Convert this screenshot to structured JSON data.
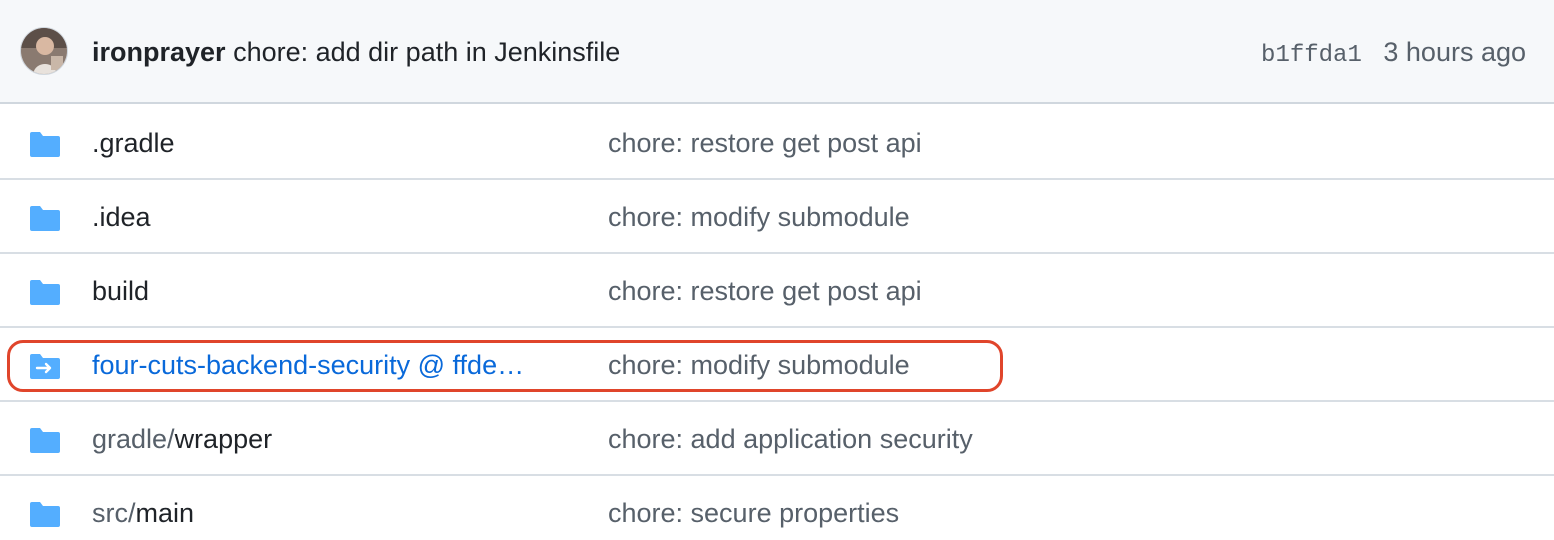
{
  "commit": {
    "author": "ironprayer",
    "message": "chore: add dir path in Jenkinsfile",
    "sha": "b1ffda1",
    "time": "3 hours ago"
  },
  "files": [
    {
      "prefix": "",
      "name": ".gradle",
      "message": "chore: restore get post api",
      "type": "folder"
    },
    {
      "prefix": "",
      "name": ".idea",
      "message": "chore: modify submodule",
      "type": "folder"
    },
    {
      "prefix": "",
      "name": "build",
      "message": "chore: restore get post api",
      "type": "folder"
    },
    {
      "prefix": "",
      "name": "four-cuts-backend-security @ ffde…",
      "message": "chore: modify submodule",
      "type": "submodule"
    },
    {
      "prefix": "gradle/",
      "name": "wrapper",
      "message": "chore: add application security",
      "type": "folder"
    },
    {
      "prefix": "src/",
      "name": "main",
      "message": "chore: secure properties",
      "type": "folder"
    }
  ],
  "colors": {
    "folder_icon": "#54aeff",
    "link": "#0969da",
    "highlight": "#e0452b",
    "header_bg": "#f6f8fa"
  },
  "icons": {
    "folder": "folder-icon",
    "submodule": "file-submodule-icon"
  }
}
